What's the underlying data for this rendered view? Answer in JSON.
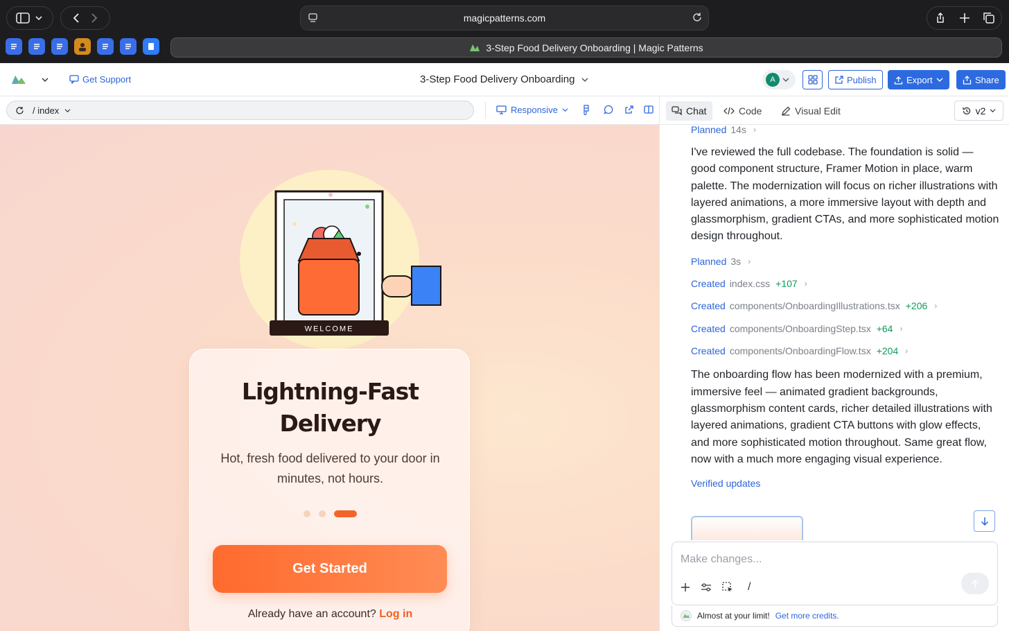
{
  "browser": {
    "url": "magicpatterns.com",
    "tab_title": "3-Step Food Delivery Onboarding | Magic Patterns"
  },
  "header": {
    "support_label": "Get Support",
    "project_title": "3-Step Food Delivery Onboarding",
    "avatar_initial": "A",
    "publish_label": "Publish",
    "export_label": "Export",
    "share_label": "Share"
  },
  "toolbar": {
    "route": "/ index",
    "viewport_label": "Responsive"
  },
  "preview": {
    "badge_text": "WELCOME",
    "headline_line1": "Lightning-Fast",
    "headline_line2": "Delivery",
    "subtitle": "Hot, fresh food delivered to your door in minutes, not hours.",
    "step_count": 3,
    "active_step": 3,
    "cta_label": "Get Started",
    "login_prompt": "Already have an account?",
    "login_link": "Log in",
    "colors": {
      "accent": "#f2642c",
      "card": "#fff5f2",
      "sun": "#fdf0c6"
    }
  },
  "panel": {
    "tabs": [
      {
        "label": "Chat",
        "icon": "chat-icon",
        "active": true
      },
      {
        "label": "Code",
        "icon": "code-icon",
        "active": false
      },
      {
        "label": "Visual Edit",
        "icon": "pencil-icon",
        "active": false
      }
    ],
    "version": "v2",
    "steps_top": {
      "verb": "Planned",
      "detail": "14s"
    },
    "message1": "I've reviewed the full codebase. The foundation is solid — good component structure, Framer Motion in place, warm palette. The modernization will focus on richer illustrations with layered animations, a more immersive layout with depth and glassmorphism, gradient CTAs, and more sophisticated motion design throughout.",
    "steps": [
      {
        "verb": "Planned",
        "detail": "3s",
        "plus": ""
      },
      {
        "verb": "Created",
        "detail": "index.css",
        "plus": "+107"
      },
      {
        "verb": "Created",
        "detail": "components/OnboardingIllustrations.tsx",
        "plus": "+206"
      },
      {
        "verb": "Created",
        "detail": "components/OnboardingStep.tsx",
        "plus": "+64"
      },
      {
        "verb": "Created",
        "detail": "components/OnboardingFlow.tsx",
        "plus": "+204"
      }
    ],
    "message2": "The onboarding flow has been modernized with a premium, immersive feel — animated gradient backgrounds, glassmorphism content cards, richer detailed illustrations with layered animations, gradient CTA buttons with glow effects, and more sophisticated motion throughout. Same great flow, now with a much more engaging visual experience.",
    "verified_label": "Verified updates",
    "composer_placeholder": "Make changes...",
    "composer_slash": "/",
    "limit_text": "Almost at your limit!",
    "limit_link": "Get more credits."
  }
}
